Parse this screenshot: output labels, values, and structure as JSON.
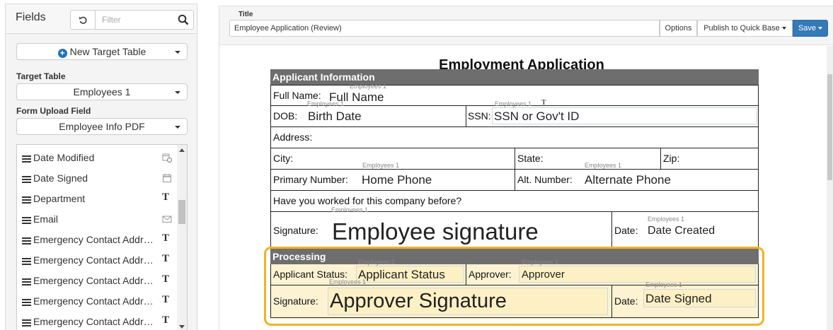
{
  "left_panel": {
    "title": "Fields",
    "filter_placeholder": "Filter",
    "new_target_table": "New Target Table",
    "target_table_label": "Target Table",
    "target_table_value": "Employees 1",
    "form_upload_label": "Form Upload Field",
    "form_upload_value": "Employee Info PDF",
    "fields": [
      {
        "name": "Date Modified",
        "type": "datetime-icon"
      },
      {
        "name": "Date Signed",
        "type": "calendar-icon"
      },
      {
        "name": "Department",
        "type": "T"
      },
      {
        "name": "Email",
        "type": "email-icon"
      },
      {
        "name": "Emergency Contact Addr…",
        "type": "T"
      },
      {
        "name": "Emergency Contact Addr…",
        "type": "T"
      },
      {
        "name": "Emergency Contact Addr…",
        "type": "T"
      },
      {
        "name": "Emergency Contact Addr…",
        "type": "T"
      },
      {
        "name": "Emergency Contact Addr…",
        "type": "T"
      }
    ]
  },
  "toolbar": {
    "title_label": "Title",
    "title_value": "Employee Application (Review)",
    "options": "Options",
    "publish": "Publish to Quick Base",
    "save": "Save",
    "accent_color": "#337ab7"
  },
  "form": {
    "title": "Employment Application",
    "applicant_section": "Applicant Information",
    "full_name_label": "Full Name:",
    "full_name_value": "Full Name",
    "dob_label": "DOB:",
    "dob_value": "Birth Date",
    "ssn_label": "SSN:",
    "ssn_value": "SSN or Gov't ID",
    "address_label": "Address:",
    "city_label": "City:",
    "state_label": "State:",
    "zip_label": "Zip:",
    "primary_label": "Primary Number:",
    "primary_value": "Home Phone",
    "alt_label": "Alt. Number:",
    "alt_value": "Alternate Phone",
    "worked_before": "Have you worked for this company before?",
    "signature_label": "Signature:",
    "signature_value": "Employee signature",
    "date_label": "Date:",
    "date_value": "Date Created",
    "processing_section": "Processing",
    "status_label": "Applicant Status:",
    "status_value": "Applicant Status",
    "approver_label": "Approver:",
    "approver_value": "Approver",
    "approver_sig_label": "Signature:",
    "approver_sig_value": "Approver Signature",
    "date2_label": "Date:",
    "date2_value": "Date Signed",
    "tag": "Employees 1",
    "highlight_color": "#f0b323"
  }
}
